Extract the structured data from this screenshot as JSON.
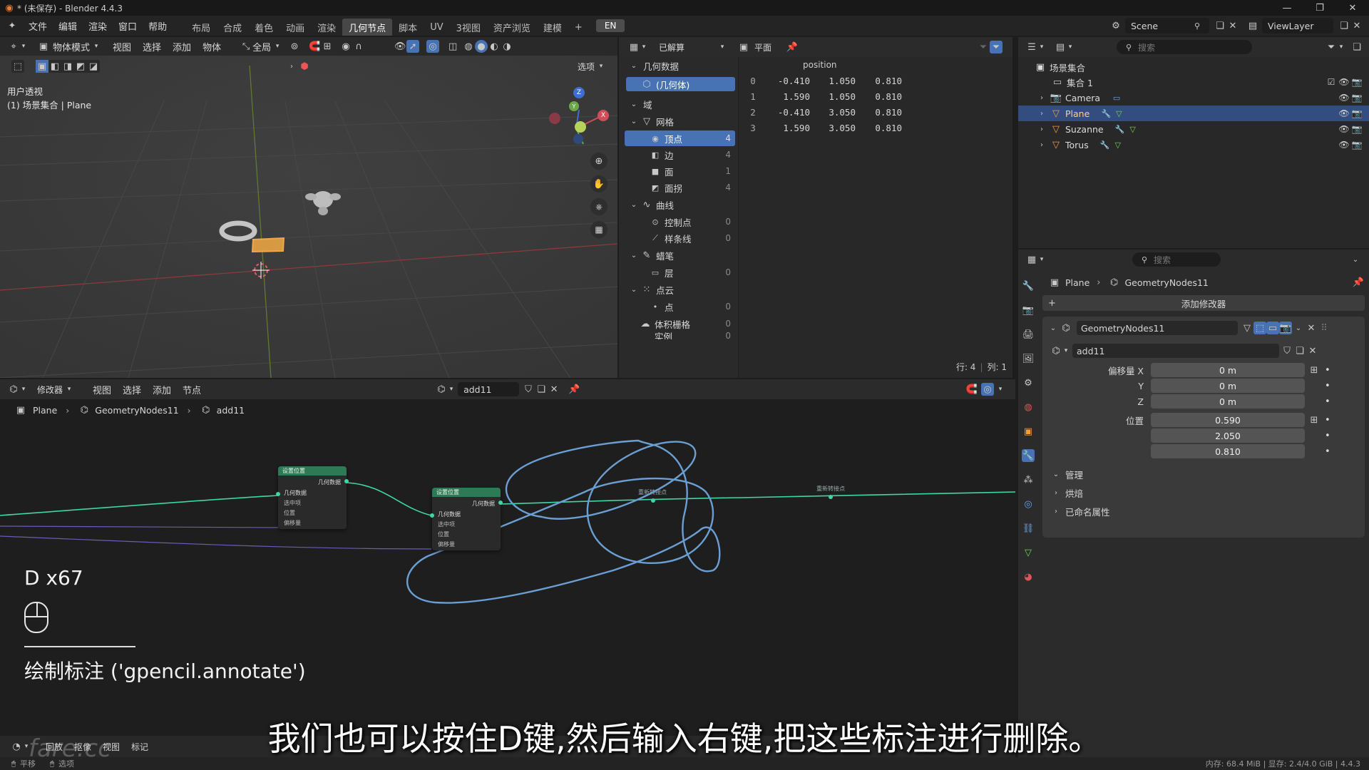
{
  "window": {
    "title": "* (未保存) - Blender 4.4.3"
  },
  "menu": [
    "文件",
    "编辑",
    "渲染",
    "窗口",
    "帮助"
  ],
  "workspaces": [
    "布局",
    "合成",
    "着色",
    "动画",
    "渲染",
    "几何节点",
    "脚本",
    "UV",
    "3视图",
    "资产浏览",
    "建模"
  ],
  "active_workspace_index": 5,
  "lang_badge": "EN",
  "scene": {
    "name": "Scene",
    "view_layer": "ViewLayer"
  },
  "viewport": {
    "mode": "物体模式",
    "menus": [
      "视图",
      "选择",
      "添加",
      "物体"
    ],
    "transform": "全局",
    "options": "选项",
    "overlay_title": "用户透视",
    "overlay_subtitle": "(1) 场景集合 | Plane",
    "gizmo_axes": {
      "z": "Z",
      "y": "Y",
      "x": "X"
    }
  },
  "spreadsheet": {
    "evaluated": "已解算",
    "plane_label": "平面",
    "tree_title": "几何数据",
    "geometry_item": "(几何体)",
    "domain_title": "域",
    "groups": [
      {
        "label": "网格",
        "items": [
          {
            "label": "顶点",
            "count": "4"
          },
          {
            "label": "边",
            "count": "4"
          },
          {
            "label": "面",
            "count": "1"
          },
          {
            "label": "面拐",
            "count": "4"
          }
        ]
      },
      {
        "label": "曲线",
        "items": [
          {
            "label": "控制点",
            "count": "0"
          },
          {
            "label": "样条线",
            "count": "0"
          }
        ]
      },
      {
        "label": "蜡笔",
        "items": [
          {
            "label": "层",
            "count": "0"
          }
        ]
      },
      {
        "label": "点云",
        "items": [
          {
            "label": "点",
            "count": "0"
          }
        ]
      }
    ],
    "volume": {
      "label": "体积栅格",
      "count": "0"
    },
    "instance": {
      "label": "实例",
      "count": "0"
    },
    "column": "position",
    "rows": [
      {
        "i": "0",
        "x": "-0.410",
        "y": "1.050",
        "z": "0.810"
      },
      {
        "i": "1",
        "x": "1.590",
        "y": "1.050",
        "z": "0.810"
      },
      {
        "i": "2",
        "x": "-0.410",
        "y": "3.050",
        "z": "0.810"
      },
      {
        "i": "3",
        "x": "1.590",
        "y": "3.050",
        "z": "0.810"
      }
    ],
    "footer_rows": "行: 4",
    "footer_cols": "列: 1"
  },
  "outliner": {
    "search_placeholder": "搜索",
    "root": "场景集合",
    "collection": "集合 1",
    "items": [
      "Camera",
      "Plane",
      "Suzanne",
      "Torus"
    ],
    "selected": "Plane"
  },
  "properties": {
    "search_placeholder": "搜索",
    "breadcrumb_obj": "Plane",
    "breadcrumb_mod": "GeometryNodes11",
    "add_modifier": "添加修改器",
    "modifier_name": "GeometryNodes11",
    "node_group": "add11",
    "offset_label": "偏移量 X",
    "offset_y_label": "Y",
    "offset_z_label": "Z",
    "offset_x": "0 m",
    "offset_y": "0 m",
    "offset_z": "0 m",
    "position_label": "位置",
    "position_x": "0.590",
    "position_y": "2.050",
    "position_z": "0.810",
    "panels": [
      "管理",
      "烘焙",
      "已命名属性"
    ]
  },
  "node_editor": {
    "editor_type": "修改器",
    "menus": [
      "视图",
      "选择",
      "添加",
      "节点"
    ],
    "group_name": "add11",
    "breadcrumb": [
      "Plane",
      "GeometryNodes11",
      "add11"
    ],
    "node1": {
      "title": "设置位置",
      "out": "几何数据",
      "inputs": [
        "几何数据",
        "选中项",
        "位置",
        "偏移量"
      ]
    },
    "node2": {
      "title": "设置位置",
      "out": "几何数据",
      "inputs": [
        "几何数据",
        "选中项",
        "位置",
        "偏移量"
      ]
    },
    "reroute1": "重新转接点",
    "reroute2": "重新转接点"
  },
  "screencast": {
    "key": "D x67",
    "operator": "绘制标注 ('gpencil.annotate')"
  },
  "subtitle": "我们也可以按住D键,然后输入右键,把这些标注进行删除。",
  "timeline": {
    "menus": [
      "回放",
      "抠像",
      "视图",
      "标记"
    ]
  },
  "statusbar": {
    "left1": "平移",
    "left2": "选项",
    "right": "内存: 68.4 MiB | 显存: 2.4/4.0 GiB | 4.4.3"
  },
  "watermark": "fare.cc",
  "colors": {
    "accent": "#4772b3",
    "node_header": "#2f7a56",
    "link": "#3fd6a6",
    "annotation": "#6b9fd4",
    "selected_row": "#334d80"
  }
}
